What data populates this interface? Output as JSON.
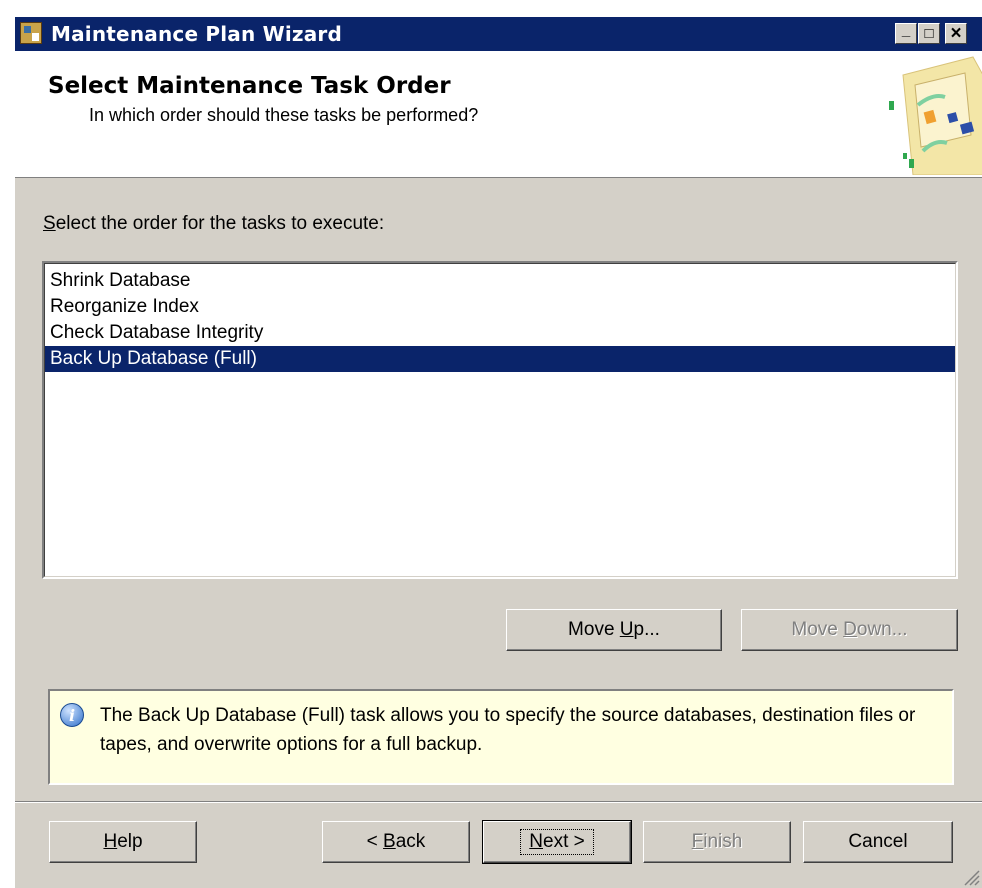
{
  "window": {
    "title": "Maintenance Plan Wizard",
    "controls": {
      "minimize": "_",
      "maximize": "□",
      "close": "×"
    }
  },
  "header": {
    "title": "Select Maintenance Task Order",
    "subtitle": "In which order should these tasks be performed?"
  },
  "prompt": {
    "mnemonic": "S",
    "rest": "elect the order for the tasks to execute:"
  },
  "tasks": {
    "items": [
      "Shrink Database",
      "Reorganize Index",
      "Check Database Integrity",
      "Back Up Database (Full)"
    ],
    "selected": "Back Up Database (Full)"
  },
  "buttons": {
    "move_up": {
      "pre": "Move ",
      "mnemonic": "U",
      "post": "p..."
    },
    "move_down": {
      "pre": "Move ",
      "mnemonic": "D",
      "post": "own..."
    },
    "help": {
      "mnemonic": "H",
      "post": "elp"
    },
    "back": {
      "pre": "< ",
      "mnemonic": "B",
      "post": "ack"
    },
    "next": {
      "mnemonic": "N",
      "post": "ext >"
    },
    "finish": {
      "mnemonic": "F",
      "post": "inish"
    },
    "cancel": "Cancel"
  },
  "info": {
    "text": "The Back Up Database (Full) task allows you to specify the source databases, destination files or tapes, and overwrite options for a full backup."
  },
  "colors": {
    "selection": "#0a246a",
    "dialog": "#d4d0c8",
    "info_background": "#ffffe1"
  }
}
